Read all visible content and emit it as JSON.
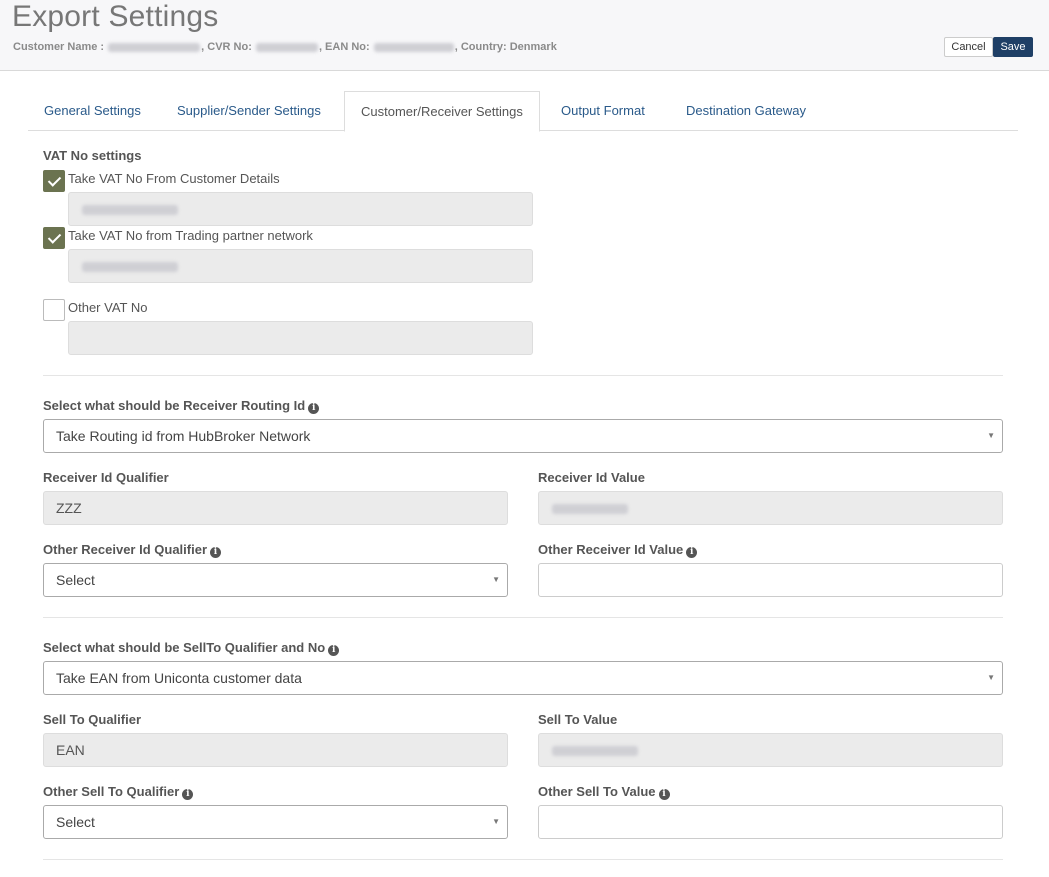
{
  "header": {
    "title": "Export Settings",
    "customer_prefix": "Customer Name :",
    "cvr_label": ", CVR No:",
    "ean_label": ", EAN No:",
    "country_text": ", Country: Denmark",
    "cancel_label": "Cancel",
    "save_label": "Save"
  },
  "tabs": [
    {
      "label": "General Settings",
      "active": false
    },
    {
      "label": "Supplier/Sender Settings",
      "active": false
    },
    {
      "label": "Customer/Receiver Settings",
      "active": true
    },
    {
      "label": "Output Format",
      "active": false
    },
    {
      "label": "Destination Gateway",
      "active": false
    }
  ],
  "vat": {
    "heading": "VAT No settings",
    "options": [
      {
        "label": "Take VAT No From Customer Details",
        "checked": true
      },
      {
        "label": "Take VAT No from Trading partner network",
        "checked": true
      },
      {
        "label": "Other VAT No",
        "checked": false
      }
    ]
  },
  "routing": {
    "heading": "Select what should be Receiver Routing Id",
    "selected": "Take Routing id from HubBroker Network",
    "qualifier_label": "Receiver Id Qualifier",
    "qualifier_value": "ZZZ",
    "value_label": "Receiver Id Value",
    "other_qualifier_label": "Other Receiver Id Qualifier",
    "other_qualifier_selected": "Select",
    "other_value_label": "Other Receiver Id Value"
  },
  "sellto": {
    "heading": "Select what should be SellTo Qualifier and No",
    "selected": "Take EAN from Uniconta customer data",
    "qualifier_label": "Sell To Qualifier",
    "qualifier_value": "EAN",
    "value_label": "Sell To Value",
    "other_qualifier_label": "Other Sell To Qualifier",
    "other_qualifier_selected": "Select",
    "other_value_label": "Other Sell To Value"
  },
  "icons": {
    "info": "info-circle-icon",
    "check": "check-icon",
    "caret": "caret-down-icon"
  },
  "colors": {
    "checked_box": "#6b7350",
    "save_button": "#1f3f66",
    "tab_link": "#2a5a8a"
  }
}
